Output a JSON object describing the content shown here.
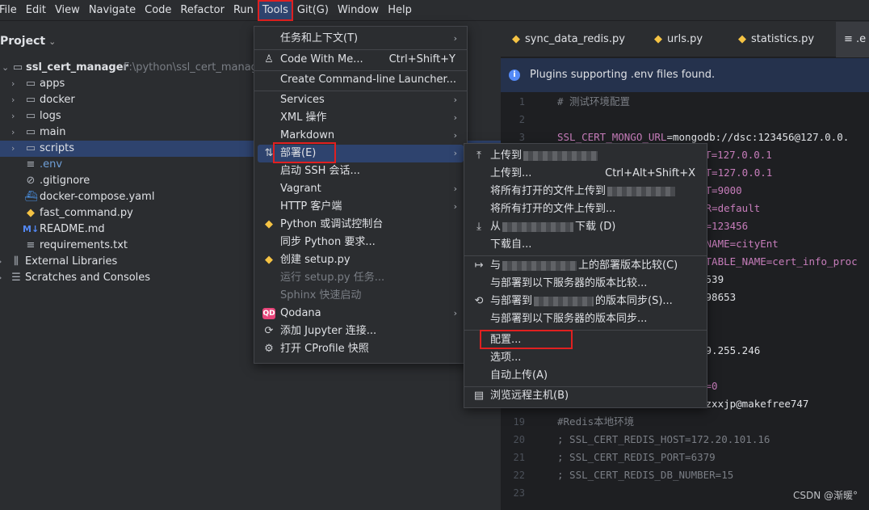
{
  "menubar": [
    "File",
    "Edit",
    "View",
    "Navigate",
    "Code",
    "Refactor",
    "Run",
    "Tools",
    "Git(G)",
    "Window",
    "Help"
  ],
  "project": {
    "title": "Project",
    "root": {
      "name": "ssl_cert_manager",
      "path": "F:\\python\\ssl_cert_manage"
    },
    "items": [
      ".env",
      ".gitignore",
      "docker-compose.yaml",
      "fast_command.py",
      "README.md",
      "requirements.txt"
    ],
    "folders": [
      "apps",
      "docker",
      "logs",
      "main",
      "scripts"
    ],
    "external": "External Libraries",
    "scratches": "Scratches and Consoles"
  },
  "tabs": [
    "sync_data_redis.py",
    "urls.py",
    "statistics.py",
    ".e"
  ],
  "notification": "Plugins supporting .env files found.",
  "editor": {
    "line_numbers": [
      "1",
      "2",
      "3",
      "19",
      "20",
      "21",
      "22",
      "23"
    ],
    "lines": {
      "l1": "# 测试环境配置",
      "l3_key": "SSL_CERT_MONGO_URL",
      "l3_val": "mongodb://dsc:123456@127.0.0.",
      "f1": "OST=127.0.0.1",
      "f2": "ST=127.0.0.1",
      "f3": "RT=9000",
      "f4": "ER=default",
      "f5": "D=123456",
      "f6": "_NAME=cityEnt",
      "f7": "_TABLE_NAME=cert_info_proc",
      "f8": "0539",
      "f9": "098653",
      "f10": "19.255.246",
      "f11": "9",
      "f12": "R=0",
      "f13": "=zxxjp@makefree747",
      "l19": "#Redis本地环境",
      "l20": "; SSL_CERT_REDIS_HOST=172.20.101.16",
      "l21": "; SSL_CERT_REDIS_PORT=6379",
      "l22": "; SSL_CERT_REDIS_DB_NUMBER=15"
    }
  },
  "tools_menu": {
    "tasks": "任务和上下文(T)",
    "code_with_me": "Code With Me...",
    "code_with_me_sc": "Ctrl+Shift+Y",
    "launcher": "Create Command-line Launcher...",
    "services": "Services",
    "xml": "XML 操作",
    "markdown": "Markdown",
    "deploy": "部署(E)",
    "ssh": "启动 SSH 会话...",
    "vagrant": "Vagrant",
    "http": "HTTP 客户端",
    "python_console": "Python 或调试控制台",
    "sync_python": "同步 Python 要求...",
    "create_setup": "创建 setup.py",
    "run_setup": "运行 setup.py 任务...",
    "sphinx": "Sphinx 快速启动",
    "qodana": "Qodana",
    "jupyter": "添加 Jupyter 连接...",
    "cprofile": "打开 CProfile 快照"
  },
  "deploy_menu": {
    "upload_to": "上传到",
    "upload_to_tail": "",
    "upload_to2": "上传到...",
    "upload_to2_sc": "Ctrl+Alt+Shift+X",
    "upload_all_to": "将所有打开的文件上传到",
    "upload_all_to2": "将所有打开的文件上传到...",
    "download_from": "从",
    "download_from_tail": "下载 (D)",
    "download_from2": "下载自...",
    "compare_prefix": "与",
    "compare_tail": "上的部署版本比较(C)",
    "compare_to": "与部署到以下服务器的版本比较...",
    "sync_prefix": "与部署到",
    "sync_tail": "的版本同步(S)...",
    "sync_to": "与部署到以下服务器的版本同步...",
    "config": "配置...",
    "options": "选项...",
    "auto_upload": "自动上传(A)",
    "browse": "浏览远程主机(B)"
  },
  "watermark": "CSDN @渐暖°"
}
